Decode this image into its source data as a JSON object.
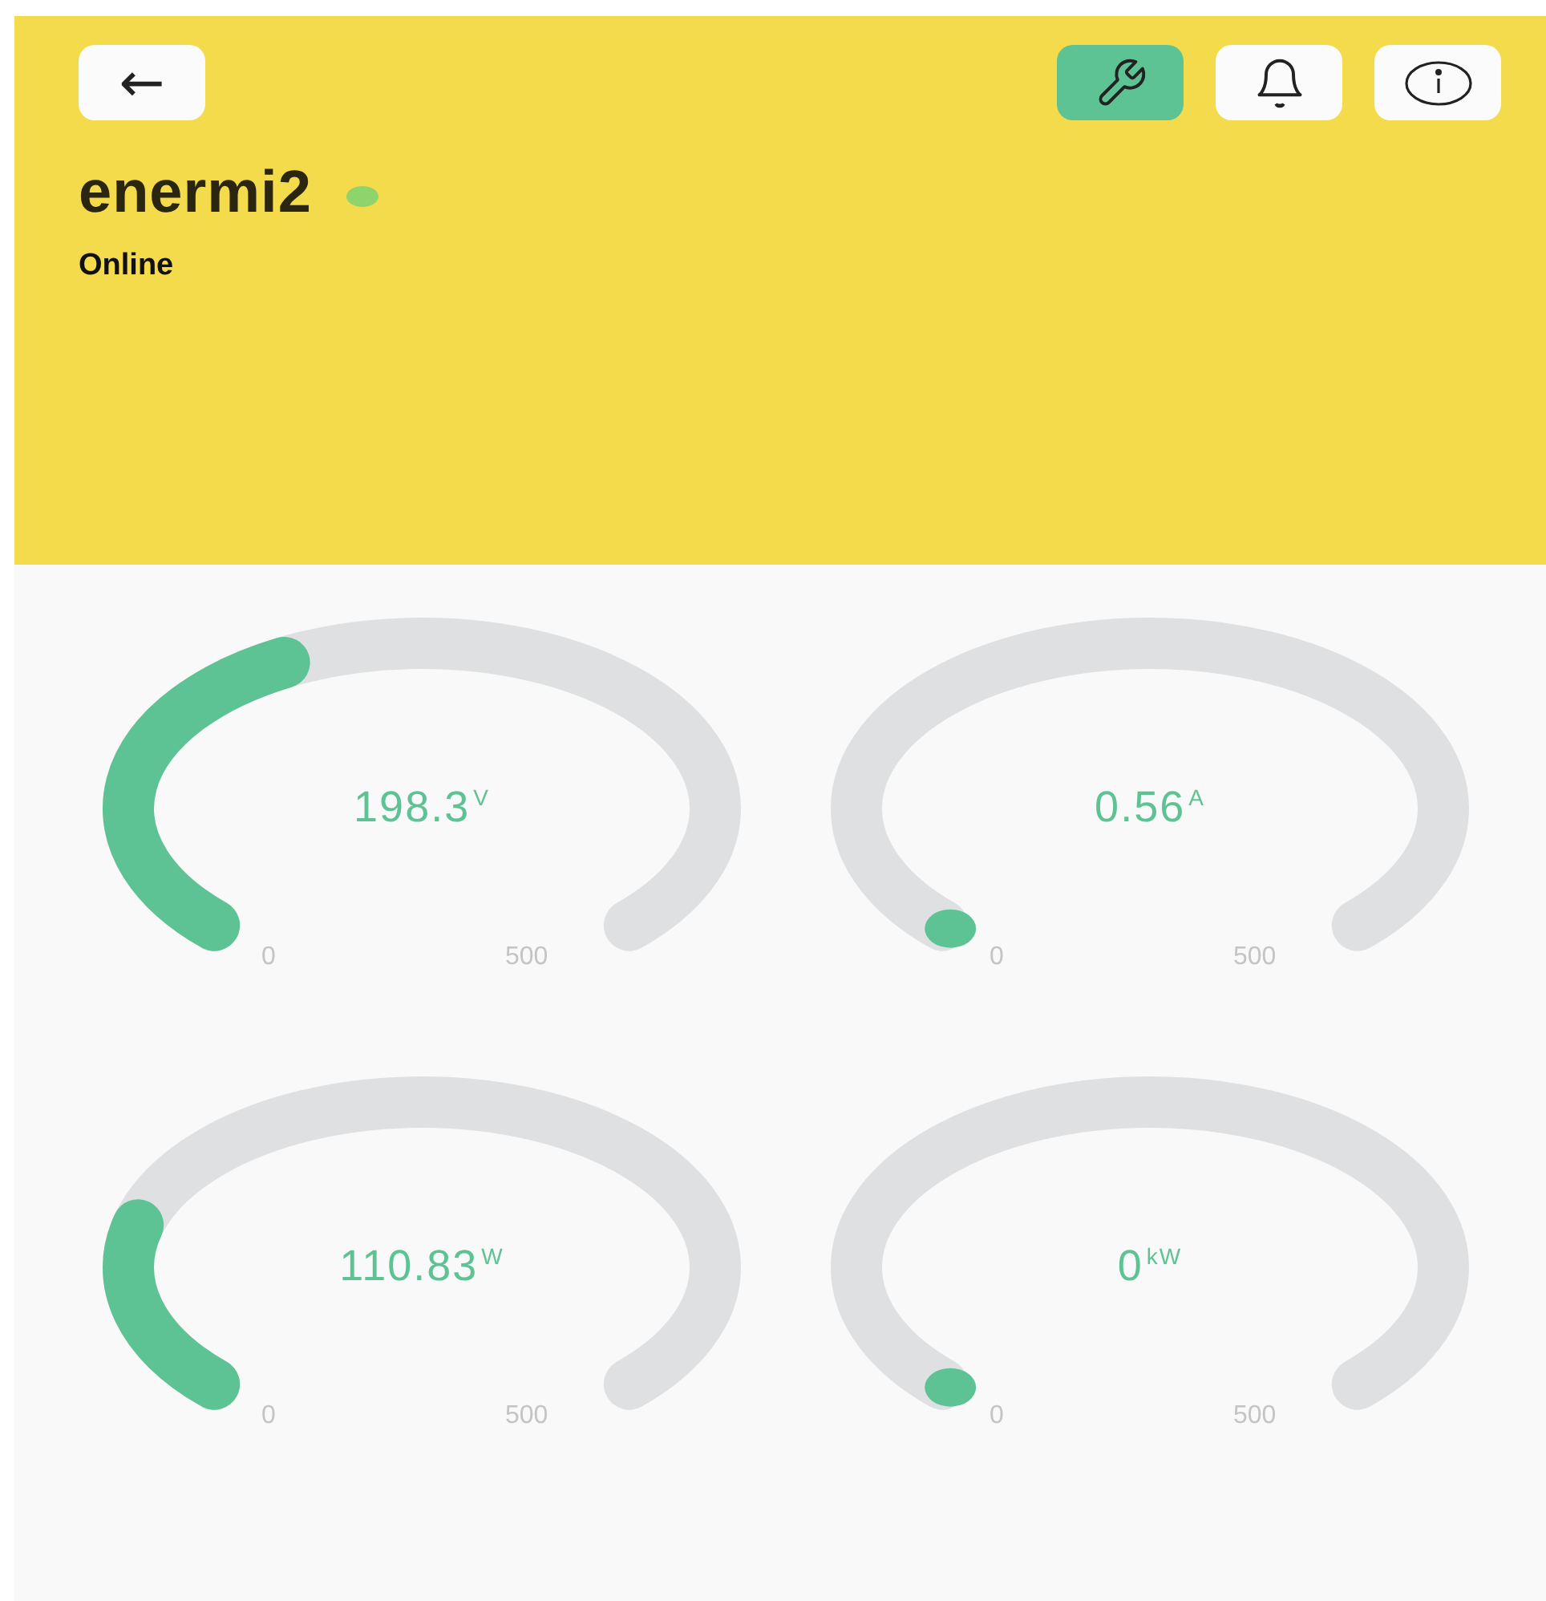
{
  "header": {
    "back_button": {
      "label": "←"
    },
    "tools": [
      {
        "kind": "wrench",
        "selected": true
      },
      {
        "kind": "bell",
        "selected": false
      },
      {
        "kind": "info",
        "selected": false
      }
    ],
    "device_name": "enermi2",
    "online": true,
    "status": "Online"
  },
  "gauges": [
    {
      "value": "198.3",
      "unit": "V",
      "min": "0",
      "max": "500"
    },
    {
      "value": "0.56",
      "unit": "A",
      "min": "0",
      "max": "500"
    },
    {
      "value": "110.83",
      "unit": "W",
      "min": "0",
      "max": "500"
    },
    {
      "value": "0",
      "unit": "kW",
      "min": "0",
      "max": "500"
    }
  ]
}
